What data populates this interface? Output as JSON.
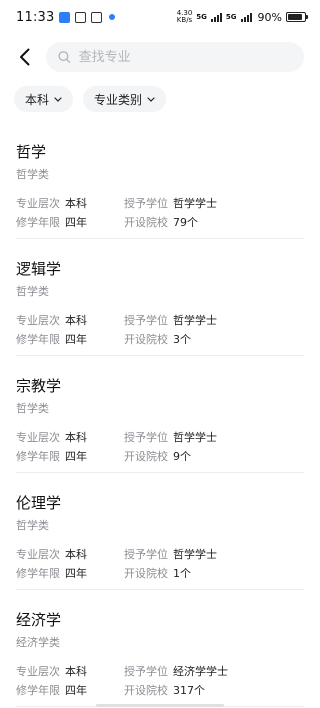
{
  "status": {
    "time": "11:33",
    "speed_top": "4.30",
    "speed_bottom": "KB/s",
    "net1": "5G",
    "net2": "5G",
    "battery": "90%",
    "battery_level": 0.9
  },
  "search": {
    "placeholder": "查找专业"
  },
  "filters": [
    {
      "label": "本科"
    },
    {
      "label": "专业类别"
    }
  ],
  "labels": {
    "level": "专业层次",
    "duration": "修学年限",
    "degree": "授予学位",
    "schools": "开设院校"
  },
  "majors": [
    {
      "name": "哲学",
      "category": "哲学类",
      "level": "本科",
      "duration": "四年",
      "degree": "哲学学士",
      "schools": "79个"
    },
    {
      "name": "逻辑学",
      "category": "哲学类",
      "level": "本科",
      "duration": "四年",
      "degree": "哲学学士",
      "schools": "3个"
    },
    {
      "name": "宗教学",
      "category": "哲学类",
      "level": "本科",
      "duration": "四年",
      "degree": "哲学学士",
      "schools": "9个"
    },
    {
      "name": "伦理学",
      "category": "哲学类",
      "level": "本科",
      "duration": "四年",
      "degree": "哲学学士",
      "schools": "1个"
    },
    {
      "name": "经济学",
      "category": "经济学类",
      "level": "本科",
      "duration": "四年",
      "degree": "经济学学士",
      "schools": "317个"
    }
  ]
}
